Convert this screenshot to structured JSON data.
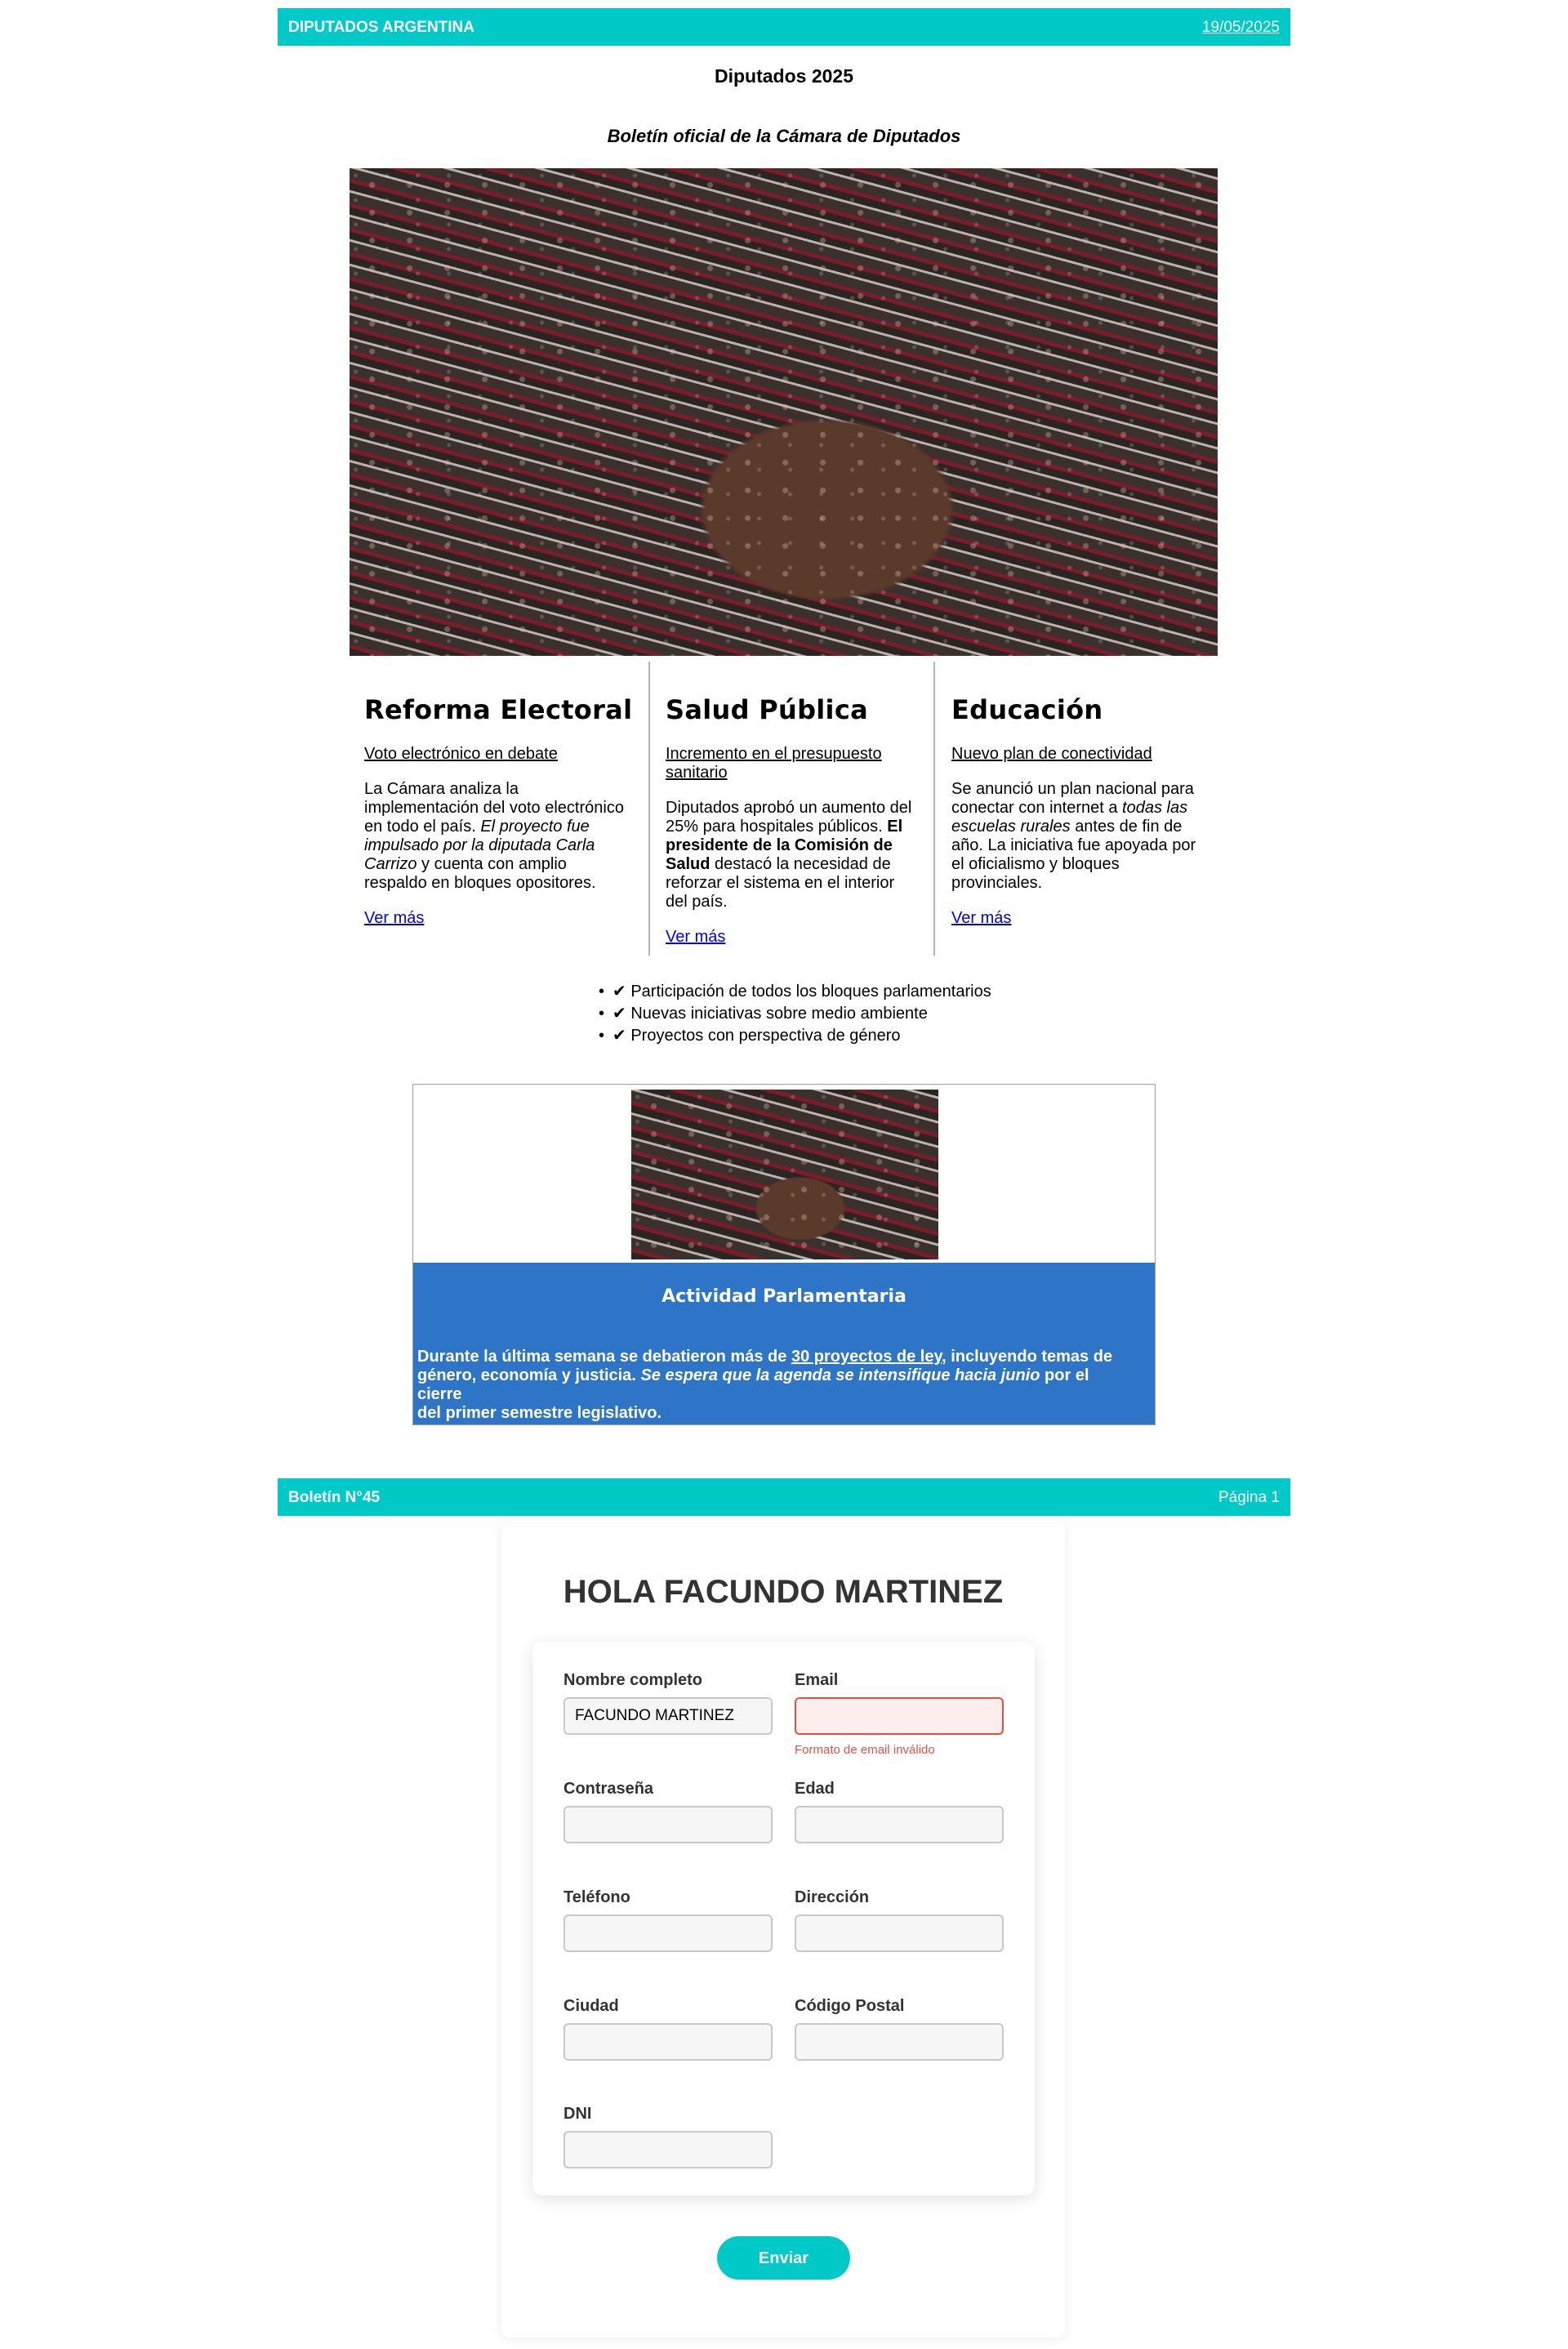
{
  "header": {
    "site_name": "DIPUTADOS ARGENTINA",
    "date": "19/05/2025"
  },
  "title": "Diputados 2025",
  "subtitle": "Boletín oficial de la Cámara de Diputados",
  "columns": [
    {
      "heading": "Reforma Electoral",
      "link_heading": "Voto electrónico en debate",
      "text_a": "La Cámara analiza la",
      "text_b": "implementación del voto electrónico",
      "text_c": "en todo el país.",
      "text_c_it": "El proyecto fue",
      "text_d_it": "impulsado por la diputada Carla",
      "text_e_it": "Carrizo",
      "text_e": "y cuenta con amplio",
      "text_f": "respaldo en bloques opositores.",
      "more": "Ver más"
    },
    {
      "heading": "Salud Pública",
      "link_heading_a": "Incremento en el presupuesto",
      "link_heading_b": "sanitario",
      "text_a": "Diputados aprobó un aumento del",
      "text_b": "25% para hospitales públicos.",
      "text_b_bold": "El",
      "text_c_bold": "presidente de la Comisión de",
      "text_d_bold": "Salud",
      "text_d": "destacó la necesidad de",
      "text_e": "reforzar el sistema en el interior",
      "text_f": "del país.",
      "more": "Ver más"
    },
    {
      "heading": "Educación",
      "link_heading": "Nuevo plan de conectividad",
      "text_a": "Se anunció un plan nacional para",
      "text_b": "conectar con internet a",
      "text_b_it": "todas las",
      "text_c_it": "escuelas rurales",
      "text_c": "antes de fin de",
      "text_d": "año. La iniciativa fue apoyada por",
      "text_e": "el oficialismo y bloques",
      "text_f": "provinciales.",
      "more": "Ver más"
    }
  ],
  "bullets": [
    "✔ Participación de todos los bloques parlamentarios",
    "✔ Nuevas iniciativas sobre medio ambiente",
    "✔ Proyectos con perspectiva de género"
  ],
  "activity": {
    "heading": "Actividad Parlamentaria",
    "p1": "Durante la última semana se debatieron más de",
    "p1_link": "30 proyectos de ley",
    "p1_b": ", incluyendo temas de",
    "p2": "género, economía y justicia.",
    "p2_it": "Se espera que la agenda se intensifique hacia junio",
    "p2_b": "por el cierre",
    "p3": "del primer semestre legislativo."
  },
  "footer": {
    "bulletin": "Boletín N°45",
    "page": "Página 1"
  },
  "form": {
    "greeting": "HOLA FACUNDO MARTINEZ",
    "fields": {
      "name_label": "Nombre completo",
      "name_value": "FACUNDO MARTINEZ",
      "email_label": "Email",
      "email_error": "Formato de email inválido",
      "password_label": "Contraseña",
      "age_label": "Edad",
      "phone_label": "Teléfono",
      "address_label": "Dirección",
      "city_label": "Ciudad",
      "zip_label": "Código Postal",
      "dni_label": "DNI"
    },
    "submit": "Enviar"
  },
  "colors": {
    "accent": "#00c9c8",
    "activity_blue": "#2e75c7",
    "error": "#e05045"
  }
}
